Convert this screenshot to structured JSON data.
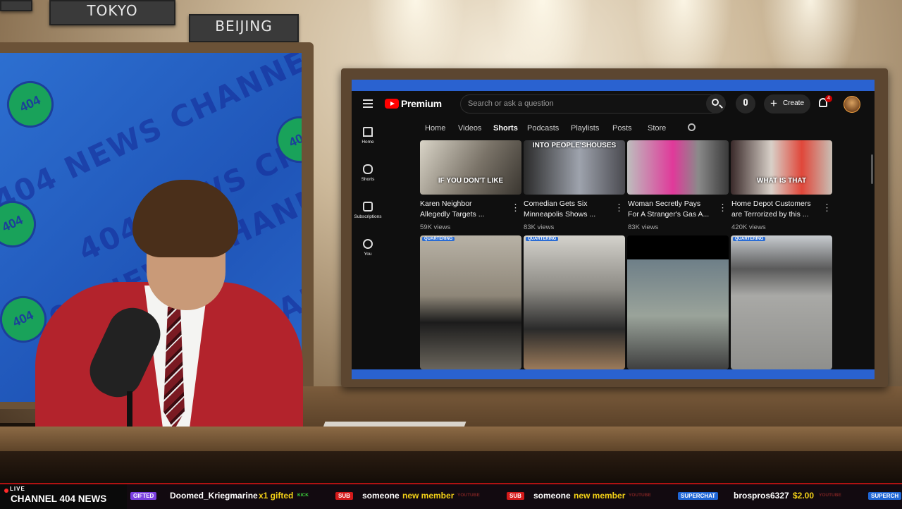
{
  "studio": {
    "city_signs": [
      "TOKYO",
      "BEIJING"
    ],
    "backdrop_text": "404 NEWS CHANNEL",
    "badge_text": "404"
  },
  "youtube": {
    "logo": "Premium",
    "search_placeholder": "Search or ask a question",
    "create_label": "Create",
    "notification_count": "4",
    "sidebar": [
      {
        "label": "Home",
        "icon": "home-icon"
      },
      {
        "label": "Shorts",
        "icon": "shorts-icon"
      },
      {
        "label": "Subscriptions",
        "icon": "subscriptions-icon"
      },
      {
        "label": "You",
        "icon": "you-icon"
      }
    ],
    "tabs": [
      "Home",
      "Videos",
      "Shorts",
      "Podcasts",
      "Playlists",
      "Posts",
      "Store"
    ],
    "active_tab": "Shorts",
    "shorts_row1": [
      {
        "title1": "Karen Neighbor",
        "title2": "Allegedly Targets ...",
        "views": "59K views",
        "caption": "IF YOU DON'T LIKE"
      },
      {
        "title1": "Comedian Gets Six",
        "title2": "Minneapolis Shows ...",
        "views": "83K views",
        "caption": "INTO PEOPLE'SHOUSES"
      },
      {
        "title1": "Woman Secretly Pays",
        "title2": "For A Stranger's Gas A...",
        "views": "83K views",
        "caption": ""
      },
      {
        "title1": "Home Depot Customers",
        "title2": "are Terrorized by this ...",
        "views": "420K views",
        "caption": "WHAT IS THAT"
      }
    ],
    "channel_tag": "QUARTERING"
  },
  "ticker": {
    "live": "LIVE",
    "channel": "CHANNEL 404 NEWS",
    "items": [
      {
        "badge": "GIFTED",
        "badge_color": "#7b3fe0",
        "name": "Doomed_Kriegmarine",
        "action": "x1 gifted",
        "source": "KICK",
        "source_color": "#3dd13d"
      },
      {
        "badge": "SUB",
        "badge_color": "#d41a1a",
        "name": "someone",
        "action": "new member",
        "source": "YOUTUBE",
        "source_color": "#7a2222"
      },
      {
        "badge": "SUB",
        "badge_color": "#d41a1a",
        "name": "someone",
        "action": "new member",
        "source": "YOUTUBE",
        "source_color": "#7a2222"
      },
      {
        "badge": "SUPERCHAT",
        "badge_color": "#1f66d6",
        "name": "brospros6327",
        "action": "$2.00",
        "source": "YOUTUBE",
        "source_color": "#7a2222"
      },
      {
        "badge": "SUPERCH",
        "badge_color": "#1f66d6",
        "name": "",
        "action": "",
        "source": "",
        "source_color": "#7a2222"
      }
    ]
  }
}
